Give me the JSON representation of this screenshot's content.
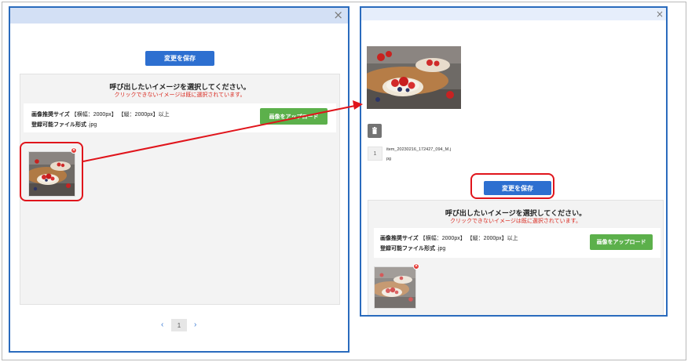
{
  "left_dialog": {
    "close_symbol": "×",
    "save_button": "変更を保存",
    "title": "呼び出したいイメージを選択してください。",
    "subtitle": "クリックできないイメージは既に選択されています。",
    "size_label": "画像推奨サイズ",
    "size_width": "【横幅：2000px】",
    "size_height": "【縦：2000px】以上",
    "format_label": "登録可能ファイル形式",
    "format_value": ".jpg",
    "upload_button": "画像をアップロード",
    "remove_symbol": "×",
    "pager": {
      "prev": "‹",
      "page": "1",
      "next": "›"
    }
  },
  "right_dialog": {
    "close_symbol": "×",
    "file_number": "1",
    "file_name_line1": "item_20230216_172427_094_M.j",
    "file_name_line2": "pg",
    "save_button": "変更を保存",
    "title": "呼び出したいイメージを選択してください。",
    "subtitle": "クリックできないイメージは既に選択されています。",
    "size_label": "画像推奨サイズ",
    "size_width": "【横幅：2000px】",
    "size_height": "【縦：2000px】以上",
    "format_label": "登録可能ファイル形式",
    "format_value": ".jpg",
    "upload_button": "画像をアップロード",
    "remove_symbol": "×"
  },
  "colors": {
    "accent_blue": "#2d6fd0",
    "upload_green": "#5cb04b",
    "highlight_red": "#e0141b",
    "panel_border": "#2a6bbd"
  },
  "icons": [
    "close-icon",
    "trash-icon",
    "remove-icon",
    "arrow-icon"
  ]
}
